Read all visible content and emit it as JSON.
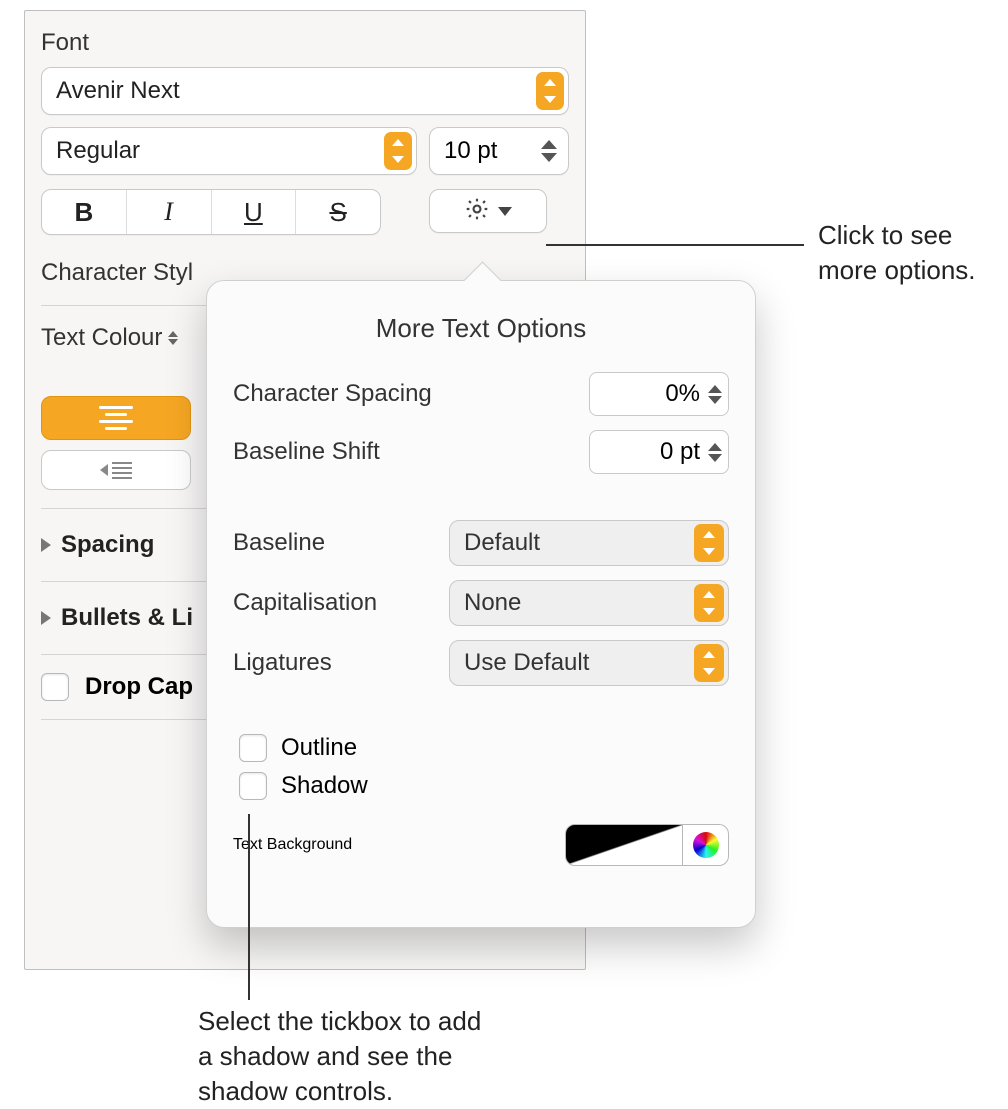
{
  "font": {
    "section_label": "Font",
    "family": "Avenir Next",
    "style": "Regular",
    "size": "10 pt",
    "bold": "B",
    "italic": "I",
    "underline": "U",
    "strike": "S"
  },
  "char_style_label": "Character Styl",
  "text_colour_label": "Text Colour",
  "spacing_label": "Spacing",
  "bullets_label": "Bullets & Li",
  "dropcap_label": "Drop Cap",
  "popover": {
    "title": "More Text Options",
    "char_spacing_label": "Character Spacing",
    "char_spacing_value": "0%",
    "baseline_shift_label": "Baseline Shift",
    "baseline_shift_value": "0 pt",
    "baseline_label": "Baseline",
    "baseline_value": "Default",
    "caps_label": "Capitalisation",
    "caps_value": "None",
    "ligatures_label": "Ligatures",
    "ligatures_value": "Use Default",
    "outline_label": "Outline",
    "shadow_label": "Shadow",
    "text_bg_label": "Text Background"
  },
  "callouts": {
    "more_options": "Click to see more options.",
    "shadow": "Select the tickbox to add a shadow and see the shadow controls."
  }
}
